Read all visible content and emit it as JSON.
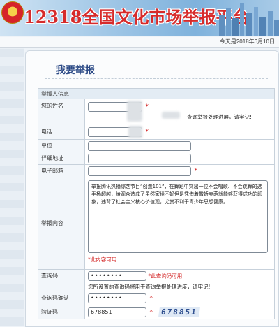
{
  "header": {
    "site_title": "12318全国文化市场举报平台",
    "date": "今天是2018年6月10日",
    "brand_color": "#d62b2b"
  },
  "page": {
    "title": "我要举报"
  },
  "form": {
    "section_title": "举报人信息",
    "name": {
      "label": "您的姓名",
      "required_mark": "*",
      "note": "查询举报处理进展，请牢记!"
    },
    "phone": {
      "label": "电话",
      "required_mark": "*"
    },
    "org": {
      "label": "单位",
      "value": ""
    },
    "address": {
      "label": "详细地址",
      "value": ""
    },
    "email": {
      "label": "电子邮箱",
      "value": "",
      "required_mark": "*"
    },
    "content": {
      "label": "举报内容",
      "value": "举报腾讯热播综艺节目“创造101”，在舞蹈中突出一位不会唱歌、不会跳舞的选手杨超越，给观众造成了虽然家境不好但是凭借着撒娇卖萌就能够获得成功的印象，违背了社会主义核心价值观，尤其不利于青少年思想健康。",
      "required_note": "*此内容可用"
    },
    "query_code": {
      "label": "查询码",
      "value": "••••••••",
      "status": "*此查询码可用",
      "note": "您所设置的查询码将用于查询举报处理进度，请牢记!"
    },
    "query_confirm": {
      "label": "查询码确认",
      "value": "••••••••",
      "required_mark": "*"
    },
    "captcha": {
      "label": "验证码",
      "value": "678851",
      "required_mark": "*",
      "image_text": "678851"
    }
  }
}
